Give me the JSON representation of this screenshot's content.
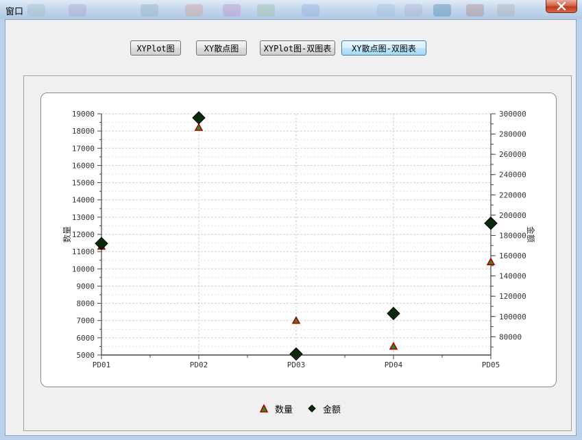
{
  "window": {
    "title": "窗口"
  },
  "buttons": [
    {
      "label": "XYPlot图",
      "active": false
    },
    {
      "label": "XY散点图",
      "active": false
    },
    {
      "label": "XYPlot图-双图表",
      "active": false
    },
    {
      "label": "XY散点图-双图表",
      "active": true
    }
  ],
  "chart_data": {
    "type": "scatter",
    "categories": [
      "PD01",
      "PD02",
      "PD03",
      "PD04",
      "PD05"
    ],
    "y_left": {
      "label": "数量",
      "range": [
        5000,
        19000
      ],
      "major": 1000,
      "minor": 500
    },
    "y_right": {
      "label": "金额",
      "range": [
        62000,
        300000
      ],
      "ticks": [
        80000,
        100000,
        120000,
        140000,
        160000,
        180000,
        200000,
        220000,
        240000,
        260000,
        280000,
        300000
      ],
      "minor": 10000
    },
    "grid": true,
    "series": [
      {
        "name": "数量",
        "axis": "left",
        "marker": "triangle",
        "color": "#b40000",
        "inner": "#2a8a2a",
        "values": [
          11300,
          18200,
          7000,
          5500,
          10400
        ]
      },
      {
        "name": "金额",
        "axis": "right",
        "marker": "diamond",
        "color": "#000000",
        "inner": "#0b2a0b",
        "values": [
          172000,
          296000,
          63000,
          103000,
          192000
        ]
      }
    ],
    "legend": "bottom-center"
  }
}
